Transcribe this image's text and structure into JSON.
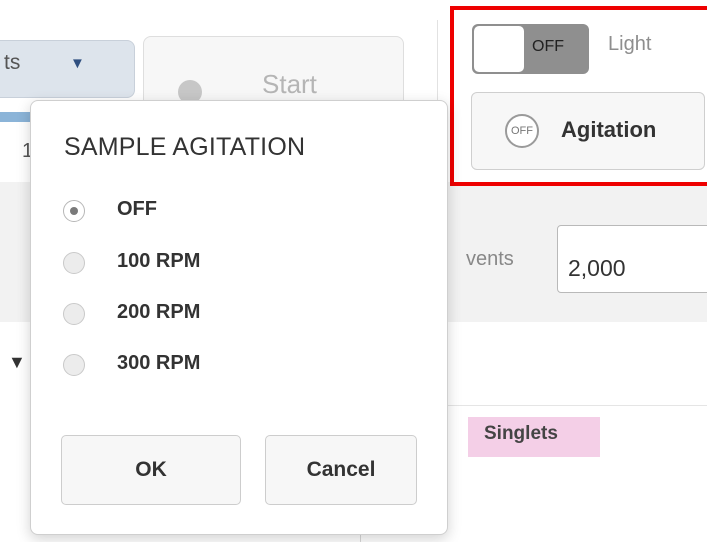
{
  "background": {
    "dropdown_text": "ts",
    "start_label": "Start",
    "row_fragment": "1",
    "events_label": "vents",
    "events_value": "2,000",
    "singlets_label": "Singlets"
  },
  "controls": {
    "light_toggle_state": "OFF",
    "light_label": "Light",
    "agitation_icon_text": "OFF",
    "agitation_label": "Agitation",
    "highlight_color": "#ee0000"
  },
  "modal": {
    "title": "SAMPLE AGITATION",
    "options": [
      {
        "label": "OFF",
        "selected": true
      },
      {
        "label": "100 RPM",
        "selected": false
      },
      {
        "label": "200 RPM",
        "selected": false
      },
      {
        "label": "300 RPM",
        "selected": false
      }
    ],
    "ok_label": "OK",
    "cancel_label": "Cancel"
  }
}
